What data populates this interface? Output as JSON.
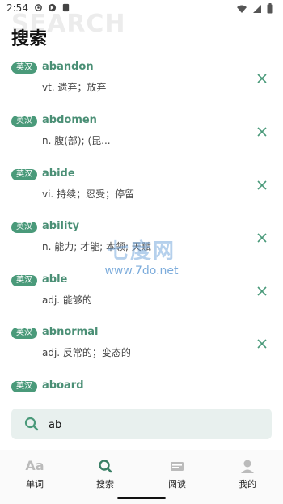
{
  "status": {
    "time": "2:54"
  },
  "page": {
    "title": "搜索",
    "watermark": "SEARCH"
  },
  "entries": [
    {
      "tag": "英汉",
      "word": "abandon",
      "definition": "vt. 遗弃；放弃"
    },
    {
      "tag": "英汉",
      "word": "abdomen",
      "definition": "n. 腹(部); (昆..."
    },
    {
      "tag": "英汉",
      "word": "abide",
      "definition": "vi. 持续；忍受；停留"
    },
    {
      "tag": "英汉",
      "word": "ability",
      "definition": "n. 能力; 才能; 本领; 天赋"
    },
    {
      "tag": "英汉",
      "word": "able",
      "definition": "adj. 能够的"
    },
    {
      "tag": "英汉",
      "word": "abnormal",
      "definition": "adj. 反常的；变态的"
    },
    {
      "tag": "英汉",
      "word": "aboard",
      "definition": ""
    }
  ],
  "watermark": {
    "big": "七度网",
    "url": "www.7do.net"
  },
  "search": {
    "value": "ab"
  },
  "nav": {
    "items": [
      {
        "label": "单词",
        "aa": "Aa"
      },
      {
        "label": "搜索"
      },
      {
        "label": "阅读"
      },
      {
        "label": "我的"
      }
    ]
  },
  "colors": {
    "accent": "#4a9a7a",
    "word": "#4a8f75",
    "searchBg": "#e8f0ee"
  }
}
